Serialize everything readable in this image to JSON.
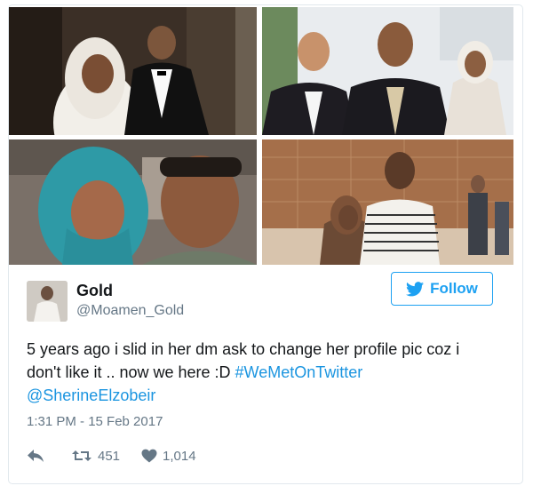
{
  "tweet": {
    "author": {
      "name": "Gold",
      "handle": "@Moamen_Gold"
    },
    "follow_label": "Follow",
    "text_main": "5 years ago i slid in her dm ask to change her profile pic coz i don't like it .. now we here :D ",
    "hashtag": "#WeMetOnTwitter",
    "mention": "@SherineElzobeir",
    "timestamp": "1:31 PM - 15 Feb 2017",
    "retweet_count": "451",
    "like_count": "1,014"
  },
  "icons": [
    "reply-icon",
    "retweet-icon",
    "heart-icon",
    "twitter-bird-icon"
  ],
  "colors": {
    "link": "#1b95e0",
    "follow_border": "#1da1f2",
    "muted": "#657786"
  }
}
